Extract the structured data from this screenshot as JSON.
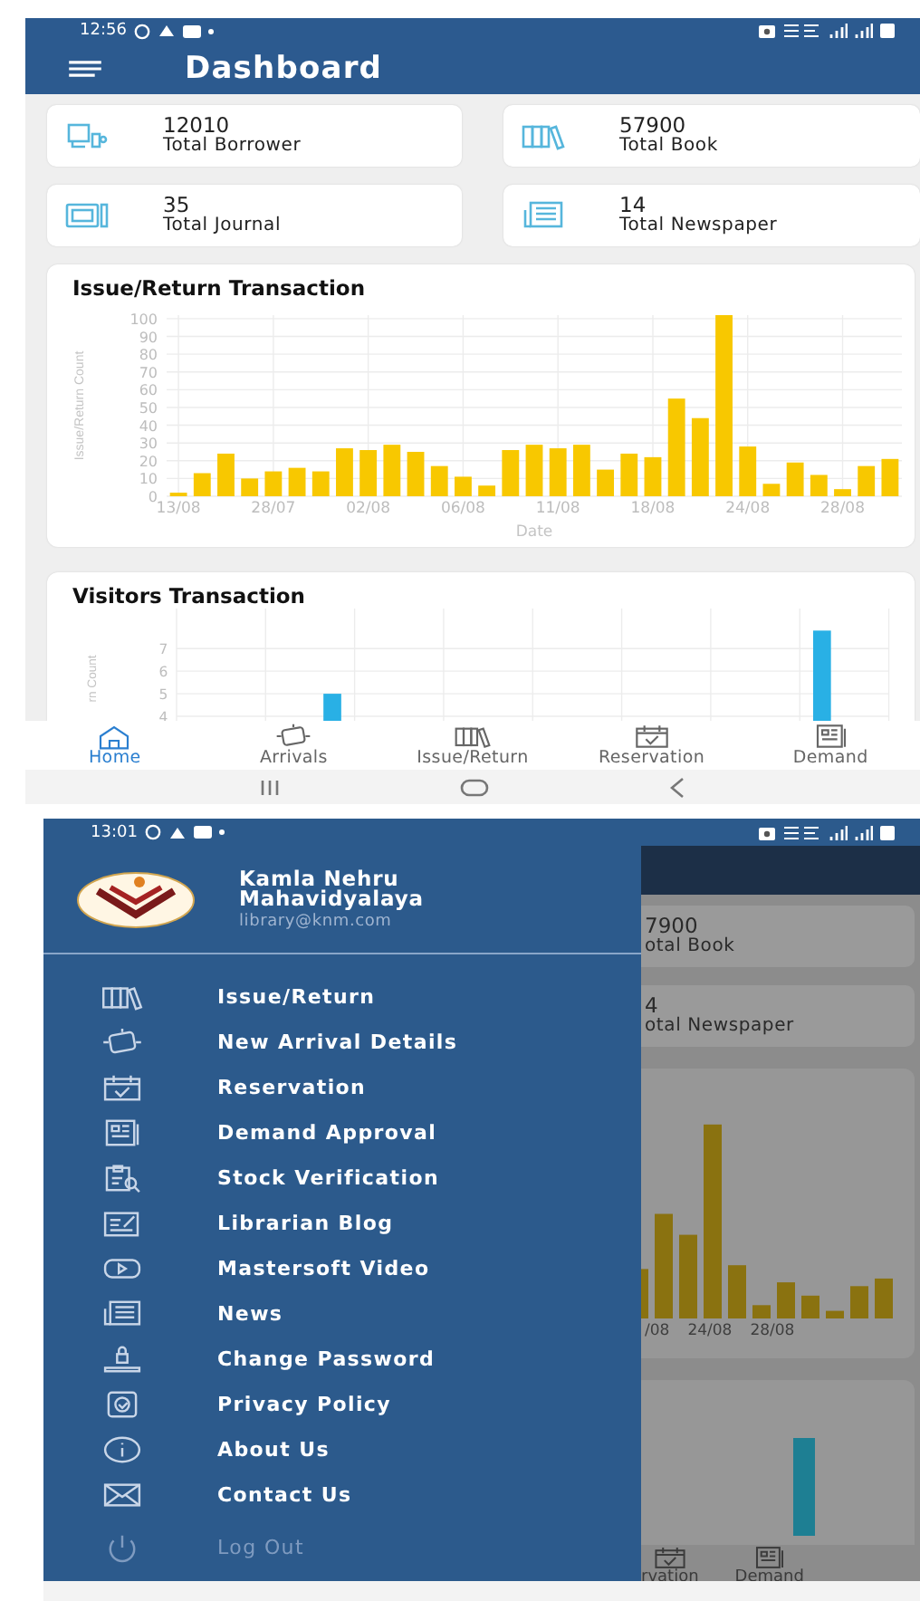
{
  "dashboard": {
    "status_bar": {
      "time": "12:56"
    },
    "app_bar": {
      "title": "Dashboard"
    },
    "stats": [
      {
        "value": "12010",
        "label": "Total Borrower"
      },
      {
        "value": "57900",
        "label": "Total Book"
      },
      {
        "value": "35",
        "label": "Total Journal"
      },
      {
        "value": "14",
        "label": "Total Newspaper"
      }
    ],
    "charts": [
      {
        "title": "Issue/Return Transaction",
        "chart_data": {
          "type": "bar",
          "xlabel": "Date",
          "ylabel": "Issue/Return Count",
          "values": [
            2,
            13,
            24,
            10,
            14,
            16,
            14,
            27,
            26,
            29,
            25,
            17,
            11,
            6,
            26,
            29,
            27,
            29,
            15,
            24,
            22,
            55,
            44,
            102,
            28,
            7,
            19,
            12,
            4,
            17,
            21
          ],
          "yticks": [
            0,
            10,
            20,
            30,
            40,
            50,
            60,
            70,
            80,
            90,
            100
          ],
          "ylim": [
            0,
            102
          ],
          "grid": true,
          "categories": [
            "13/08",
            null,
            null,
            null,
            "28/07",
            null,
            null,
            null,
            "02/08",
            null,
            null,
            null,
            "06/08",
            null,
            null,
            null,
            "11/08",
            null,
            null,
            null,
            "18/08",
            null,
            null,
            null,
            "24/08",
            null,
            null,
            null,
            "28/08",
            null,
            null
          ]
        }
      },
      {
        "title": "Visitors Transaction",
        "chart_data": {
          "type": "bar",
          "ylabel": "rn Count",
          "values": [
            null,
            null,
            null,
            5,
            null,
            null,
            null,
            null,
            null,
            null,
            null,
            null,
            null,
            null,
            7.8,
            null
          ],
          "yticks": [
            4,
            5,
            6,
            7
          ],
          "ylim": [
            3.8,
            8
          ],
          "grid": true
        }
      }
    ],
    "bottom_nav": [
      {
        "label": "Home",
        "selected": true
      },
      {
        "label": "Arrivals",
        "selected": false
      },
      {
        "label": "Issue/Return",
        "selected": false
      },
      {
        "label": "Reservation",
        "selected": false
      },
      {
        "label": "Demand",
        "selected": false
      }
    ]
  },
  "drawer_screen": {
    "status_bar": {
      "time": "13:01"
    },
    "drawer": {
      "name": "Kamla Nehru Mahavidyalaya",
      "email": "library@knm.com",
      "items": [
        {
          "label": "Issue/Return",
          "disabled": false
        },
        {
          "label": "New Arrival Details",
          "disabled": false
        },
        {
          "label": "Reservation",
          "disabled": false
        },
        {
          "label": "Demand Approval",
          "disabled": false
        },
        {
          "label": "Stock Verification",
          "disabled": false
        },
        {
          "label": "Librarian Blog",
          "disabled": false
        },
        {
          "label": "Mastersoft Video",
          "disabled": false
        },
        {
          "label": "News",
          "disabled": false
        },
        {
          "label": "Change Password",
          "disabled": false
        },
        {
          "label": "Privacy Policy",
          "disabled": false
        },
        {
          "label": "About Us",
          "disabled": false
        },
        {
          "label": "Contact Us",
          "disabled": false
        },
        {
          "label": "Log Out",
          "disabled": true
        }
      ]
    },
    "background": {
      "stats": [
        {
          "value": "7900",
          "label": "otal Book"
        },
        {
          "value": "4",
          "label": "otal Newspaper"
        }
      ],
      "chart_x_labels": [
        "/08",
        "24/08",
        "28/08"
      ],
      "bottom_nav": [
        "rvation",
        "Demand"
      ]
    }
  }
}
